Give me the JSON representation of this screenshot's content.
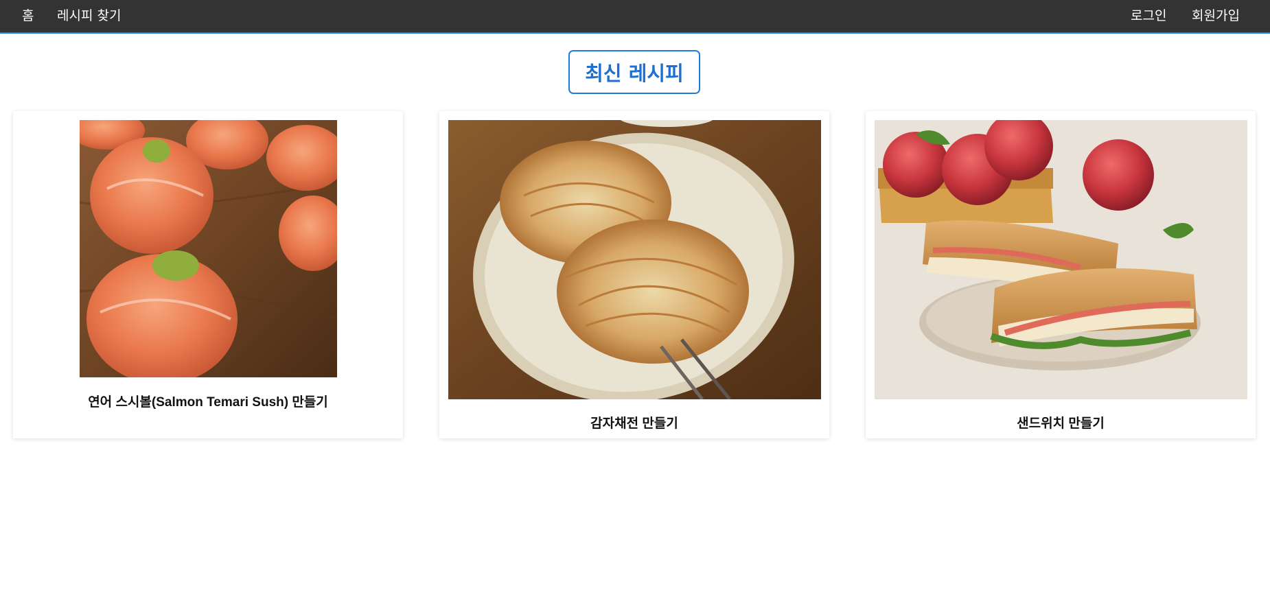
{
  "nav": {
    "home": "홈",
    "find_recipes": "레시피 찾기",
    "login": "로그인",
    "signup": "회원가입"
  },
  "section": {
    "title": "최신 레시피"
  },
  "recipes": [
    {
      "title": "연어 스시볼(Salmon Temari Sush) 만들기",
      "image": "salmon-temari-sushi-photo"
    },
    {
      "title": "감자채전 만들기",
      "image": "potato-pancake-photo"
    },
    {
      "title": "샌드위치 만들기",
      "image": "apple-brie-sandwich-photo"
    }
  ],
  "colors": {
    "navbar_bg": "#333333",
    "accent": "#1e7be0",
    "title_text": "#1e6fd0"
  }
}
